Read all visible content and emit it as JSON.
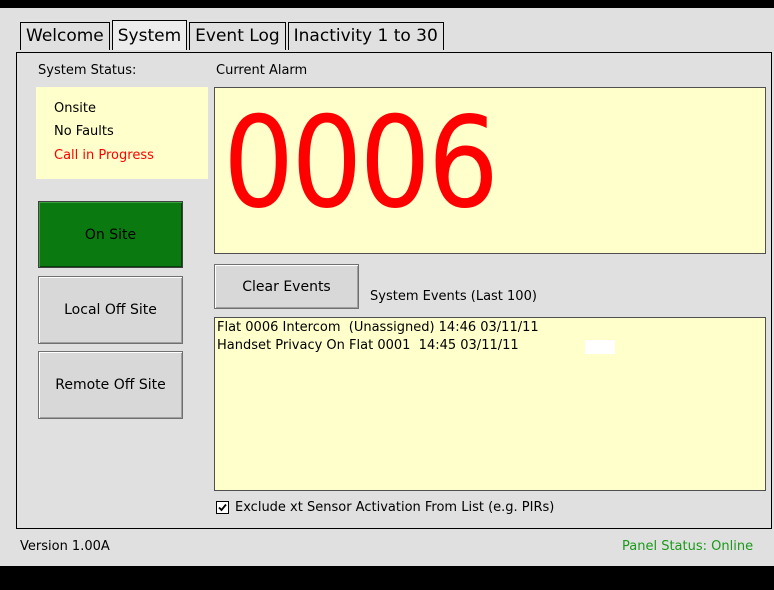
{
  "tabs": [
    {
      "label": "Welcome"
    },
    {
      "label": "System"
    },
    {
      "label": "Event Log"
    },
    {
      "label": "Inactivity 1 to 30"
    }
  ],
  "system_status": {
    "label": "System Status:",
    "lines": [
      "Onsite",
      "No Faults",
      "Call in Progress"
    ]
  },
  "buttons": {
    "on_site": "On Site",
    "local_off_site": "Local Off Site",
    "remote_off_site": "Remote Off Site",
    "clear_events": "Clear Events"
  },
  "current_alarm": {
    "label": "Current Alarm",
    "value": "0006"
  },
  "events": {
    "label": "System Events (Last 100)",
    "items": [
      "Flat 0006 Intercom  (Unassigned) 14:46 03/11/11",
      "Handset Privacy On Flat 0001  14:45 03/11/11"
    ]
  },
  "exclude_checkbox": {
    "label": "Exclude xt Sensor Activation From List (e.g. PIRs)",
    "checked": true
  },
  "footer": {
    "version": "Version 1.00A",
    "panel_status": "Panel Status: Online"
  },
  "colors": {
    "alarm_red": "#ff0000",
    "status_green": "#1a9a1a",
    "on_site_green": "#0a7a10",
    "info_yellow": "#ffffcc"
  }
}
